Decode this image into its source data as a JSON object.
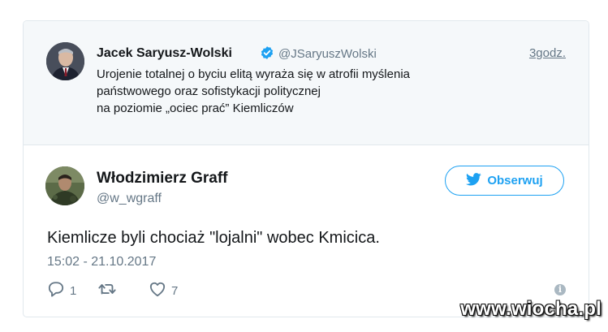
{
  "quoted_tweet": {
    "author_name": "Jacek Saryusz-Wolski",
    "handle": "@JSaryuszWolski",
    "time": "3godz.",
    "text_lines": [
      "Urojenie totalnej o byciu elitą wyraża się w atrofii myślenia",
      "państwowego oraz sofistykacji politycznej",
      "na poziomie „ociec prać” Kiemliczów"
    ]
  },
  "main_tweet": {
    "author_name": "Włodzimierz Graff",
    "handle": "@w_wgraff",
    "follow_label": "Obserwuj",
    "text": "Kiemlicze byli chociaż \"lojalni\" wobec Kmicica.",
    "timestamp": "15:02 - 21.10.2017",
    "reply_count": "1",
    "retweet_count": "",
    "like_count": "7"
  },
  "watermark": "www.wiocha.pl",
  "colors": {
    "accent": "#1da1f2",
    "muted": "#657786",
    "quoted_bg": "#f5f8fa",
    "border": "#e1e8ed"
  },
  "icons": [
    "verified-badge-icon",
    "twitter-bird-icon",
    "reply-icon",
    "retweet-icon",
    "like-icon",
    "info-icon"
  ]
}
